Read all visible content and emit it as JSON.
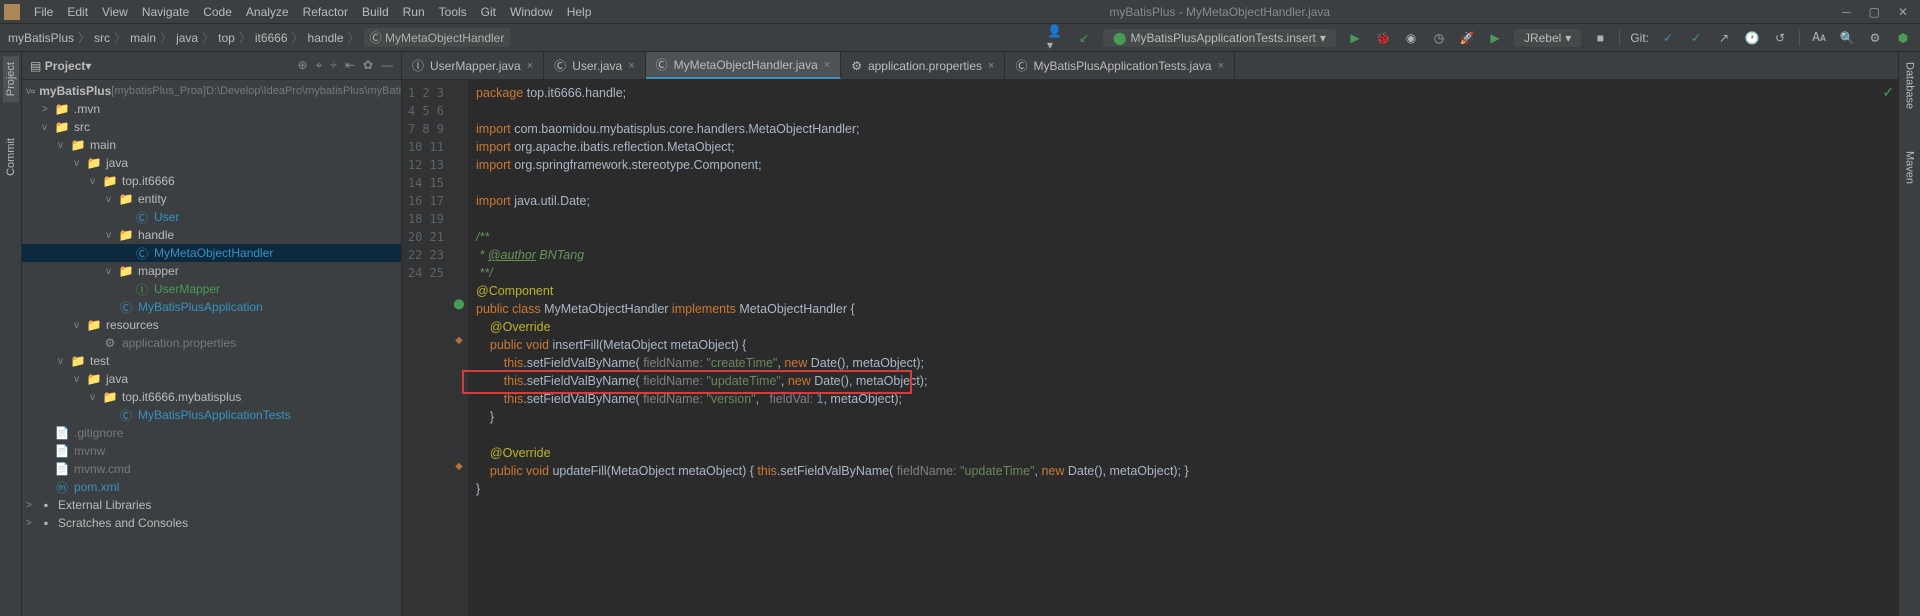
{
  "window": {
    "title": "myBatisPlus - MyMetaObjectHandler.java"
  },
  "menu": [
    "File",
    "Edit",
    "View",
    "Navigate",
    "Code",
    "Analyze",
    "Refactor",
    "Build",
    "Run",
    "Tools",
    "Git",
    "Window",
    "Help"
  ],
  "breadcrumb": [
    "myBatisPlus",
    "src",
    "main",
    "java",
    "top",
    "it6666",
    "handle",
    "MyMetaObjectHandler"
  ],
  "run": {
    "config": "MyBatisPlusApplicationTests.insert",
    "jrebel": "JRebel",
    "git_label": "Git:"
  },
  "project_panel": {
    "title": "Project"
  },
  "tree": {
    "root": "myBatisPlus",
    "root_hint": "[mybatisPlus_Proa]",
    "root_path": "D:\\Develop\\IdeaPro\\mybatisPlus\\myBatis",
    "items": [
      {
        "indent": 1,
        "arrow": ">",
        "icon": "📁",
        "label": ".mvn"
      },
      {
        "indent": 1,
        "arrow": "v",
        "icon": "📁",
        "label": "src"
      },
      {
        "indent": 2,
        "arrow": "v",
        "icon": "📁",
        "label": "main"
      },
      {
        "indent": 3,
        "arrow": "v",
        "icon": "📁",
        "label": "java",
        "blue": true
      },
      {
        "indent": 4,
        "arrow": "v",
        "icon": "📁",
        "label": "top.it6666"
      },
      {
        "indent": 5,
        "arrow": "v",
        "icon": "📁",
        "label": "entity"
      },
      {
        "indent": 6,
        "arrow": "",
        "icon": "Ⓒ",
        "label": "User",
        "cls": "fblue"
      },
      {
        "indent": 5,
        "arrow": "v",
        "icon": "📁",
        "label": "handle"
      },
      {
        "indent": 6,
        "arrow": "",
        "icon": "Ⓒ",
        "label": "MyMetaObjectHandler",
        "cls": "fblue",
        "selected": true
      },
      {
        "indent": 5,
        "arrow": "v",
        "icon": "📁",
        "label": "mapper"
      },
      {
        "indent": 6,
        "arrow": "",
        "icon": "Ⓘ",
        "label": "UserMapper",
        "cls": "fgreen"
      },
      {
        "indent": 5,
        "arrow": "",
        "icon": "Ⓒ",
        "label": "MyBatisPlusApplication",
        "cls": "fblue"
      },
      {
        "indent": 3,
        "arrow": "v",
        "icon": "📁",
        "label": "resources"
      },
      {
        "indent": 4,
        "arrow": "",
        "icon": "⚙",
        "label": "application.properties",
        "muted": true
      },
      {
        "indent": 2,
        "arrow": "v",
        "icon": "📁",
        "label": "test"
      },
      {
        "indent": 3,
        "arrow": "v",
        "icon": "📁",
        "label": "java",
        "green": true
      },
      {
        "indent": 4,
        "arrow": "v",
        "icon": "📁",
        "label": "top.it6666.mybatisplus"
      },
      {
        "indent": 5,
        "arrow": "",
        "icon": "Ⓒ",
        "label": "MyBatisPlusApplicationTests",
        "cls": "fblue"
      },
      {
        "indent": 1,
        "arrow": "",
        "icon": "📄",
        "label": ".gitignore",
        "muted": true
      },
      {
        "indent": 1,
        "arrow": "",
        "icon": "📄",
        "label": "mvnw",
        "muted": true
      },
      {
        "indent": 1,
        "arrow": "",
        "icon": "📄",
        "label": "mvnw.cmd",
        "muted": true
      },
      {
        "indent": 1,
        "arrow": "",
        "icon": "ⓜ",
        "label": "pom.xml",
        "cls": "fblue"
      }
    ],
    "ext_libs": "External Libraries",
    "scratches": "Scratches and Consoles"
  },
  "editor_tabs": [
    {
      "icon": "Ⓘ",
      "cls": "fgreen",
      "label": "UserMapper.java"
    },
    {
      "icon": "Ⓒ",
      "cls": "fblue",
      "label": "User.java"
    },
    {
      "icon": "Ⓒ",
      "cls": "fblue",
      "label": "MyMetaObjectHandler.java",
      "active": true
    },
    {
      "icon": "⚙",
      "cls": "",
      "label": "application.properties"
    },
    {
      "icon": "Ⓒ",
      "cls": "fblue",
      "label": "MyBatisPlusApplicationTests.java"
    }
  ],
  "code": {
    "line1": {
      "pkg": "package",
      "path": " top.it6666.handle;"
    },
    "line3": {
      "imp": "import",
      "path": " com.baomidou.mybatisplus.core.handlers.MetaObjectHandler;"
    },
    "line4": {
      "imp": "import",
      "path": " org.apache.ibatis.reflection.MetaObject;"
    },
    "line5": {
      "imp": "import",
      "p1": " org.springframework.stereotype.",
      "cls": "Component",
      "end": ";"
    },
    "line7": {
      "imp": "import",
      "path": " java.util.Date;"
    },
    "line9": "/**",
    "line10a": " * ",
    "line10b": "@author",
    "line10c": " BNTang",
    "line11": " **/",
    "line12": "@Component",
    "line13": {
      "pub": "public class ",
      "name": "MyMetaObjectHandler ",
      "impl": "implements ",
      "iface": "MetaObjectHandler {"
    },
    "line14": "@Override",
    "line15": {
      "pub": "public void ",
      "name": "insertFill",
      "args": "(MetaObject metaObject) {"
    },
    "line16": {
      "this": "this",
      "call": ".setFieldValByName(",
      "h1": " fieldName: ",
      "s1": "\"createTime\"",
      "mid": ", ",
      "new": "new ",
      "d": "Date(), metaObject);"
    },
    "line17": {
      "this": "this",
      "call": ".setFieldValByName(",
      "h1": " fieldName: ",
      "s1": "\"updateTime\"",
      "mid": ", ",
      "new": "new ",
      "d": "Date(), metaObject);"
    },
    "line18": {
      "this": "this",
      "call": ".setFieldValByName(",
      "h1": " fieldName: ",
      "s1": "\"version\"",
      "mid": ",   ",
      "h2": "fieldVal: ",
      "n": "1",
      "end": ", metaObject);"
    },
    "line19": "}",
    "line21": "@Override",
    "line22": {
      "pub": "public void ",
      "name": "updateFill",
      "args": "(MetaObject metaObject) { ",
      "this": "this",
      "call": ".setFieldValByName(",
      "h1": " fieldName: ",
      "s1": "\"updateTime\"",
      "mid": ", ",
      "new": "new ",
      "d": "Date(), metaObject); }"
    },
    "line23": "}"
  },
  "side_tabs": {
    "project": "Project",
    "commit": "Commit",
    "database": "Database",
    "maven": "Maven"
  }
}
